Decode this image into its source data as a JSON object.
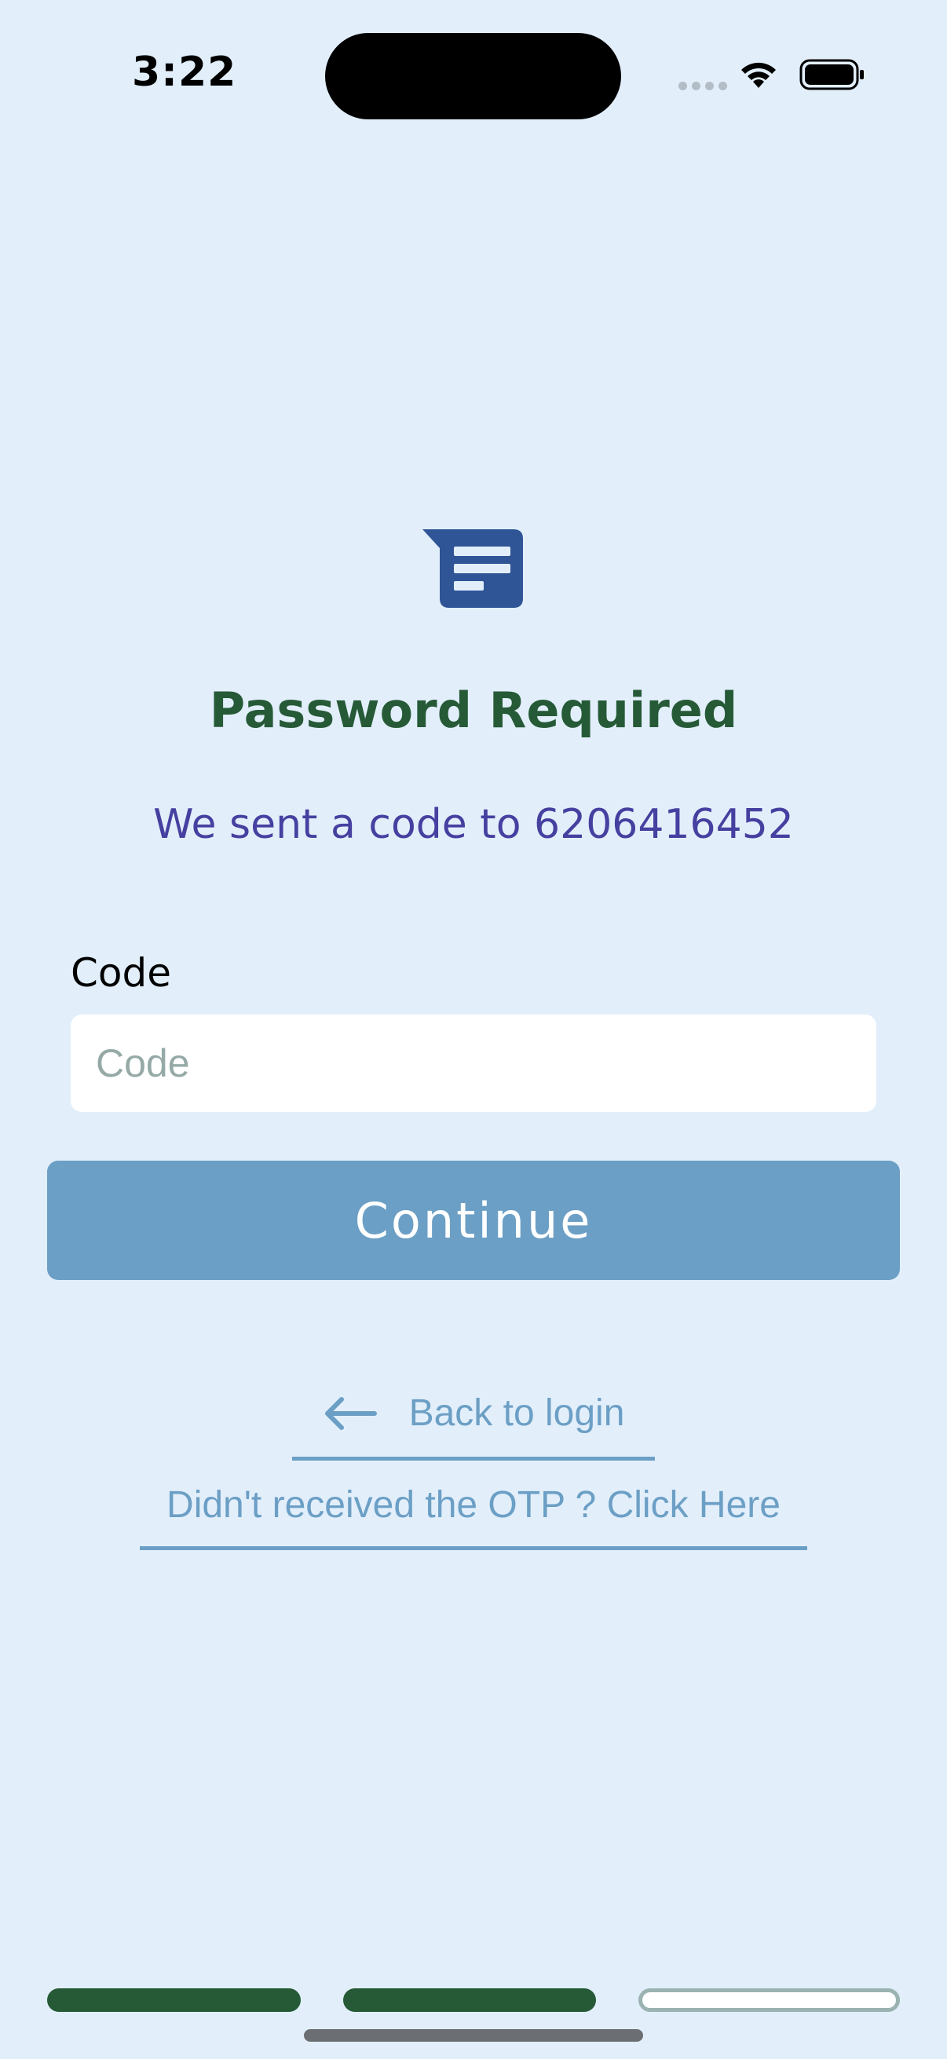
{
  "status_bar": {
    "time": "3:22"
  },
  "header": {
    "icon": "message-icon",
    "title": "Password Required",
    "subtitle": "We sent a code to 6206416452"
  },
  "form": {
    "code_label": "Code",
    "code_placeholder": "Code",
    "code_value": "",
    "continue_label": "Continue"
  },
  "links": {
    "back_label": "Back to login",
    "back_icon": "arrow-left-icon",
    "resend_label": "Didn't received the OTP ? Click Here"
  },
  "progress": {
    "steps_total": 3,
    "steps_completed": 2
  },
  "colors": {
    "background": "#e2effb",
    "title": "#265a37",
    "subtitle": "#4640a0",
    "accent": "#6c9fc5",
    "icon": "#2f5597",
    "step_done": "#265a37"
  }
}
